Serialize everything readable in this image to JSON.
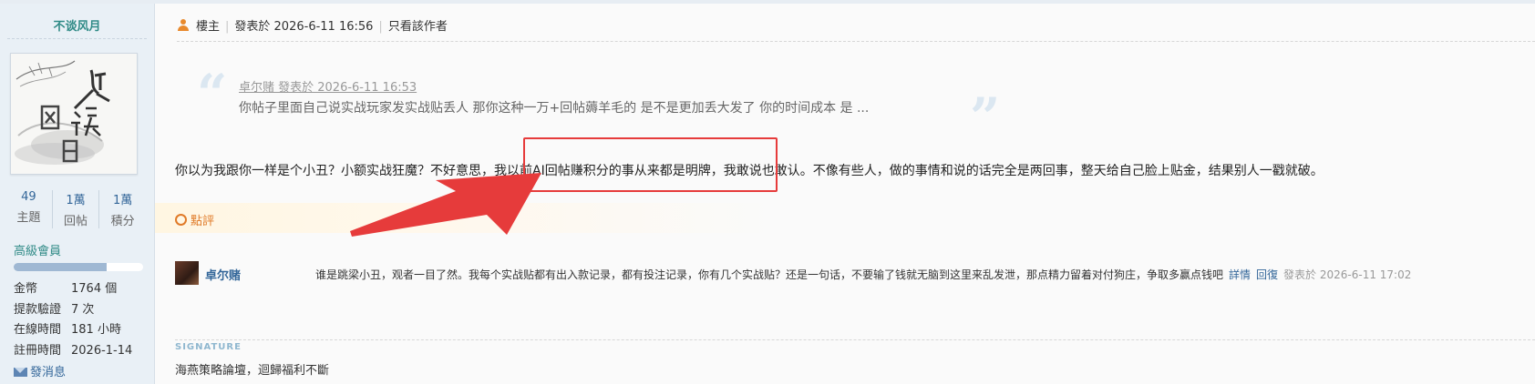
{
  "user": {
    "name": "不谈风月",
    "avatar_icon": "ink-painting-avatar",
    "stats": [
      {
        "value": "49",
        "label": "主題"
      },
      {
        "value": "1萬",
        "label": "回帖"
      },
      {
        "value": "1萬",
        "label": "積分"
      }
    ],
    "level": "高級會員",
    "level_progress": 0.72,
    "info": [
      {
        "key": "金幣",
        "value": "1764 個"
      },
      {
        "key": "提款驗證",
        "value": "7 次"
      },
      {
        "key": "在線時間",
        "value": "181 小時"
      },
      {
        "key": "註冊時間",
        "value": "2026-1-14"
      }
    ],
    "pm_label": "發消息"
  },
  "post": {
    "role": "樓主",
    "posted_at": "發表於 2026-6-11 16:56",
    "only_author": "只看該作者",
    "quote": {
      "header": "卓尔赌 發表於 2026-6-11 16:53",
      "body": "你帖子里面自己说实战玩家发实战贴丢人 那你这种一万+回帖薅羊毛的 是不是更加丢大发了 你的时间成本 是 ..."
    },
    "message": "你以为我跟你一样是个小丑？小额实战狂魔？不好意思，我以前AI回帖赚积分的事从来都是明牌，我敢说也敢认。不像有些人，做的事情和说的话完全是两回事，整天给自己脸上贴金，结果别人一戳就破。",
    "rate_label": "點評"
  },
  "comment": {
    "author": "卓尔赌",
    "text": "谁是跳梁小丑，观者一目了然。我每个实战贴都有出入款记录，都有投注记录，你有几个实战贴？还是一句话，不要输了钱就无脑到这里来乱发泄，那点精力留着对付狗庄，争取多赢点钱吧",
    "detail": "詳情",
    "reply": "回復",
    "time": "發表於 2026-6-11 17:02"
  },
  "signature": {
    "label": "SIGNATURE",
    "text": "海燕策略論壇，迴歸福利不斷"
  },
  "colors": {
    "accent": "#336699",
    "teal": "#2f8a86",
    "orange": "#e07a28",
    "annotation_red": "#e63b3b"
  }
}
